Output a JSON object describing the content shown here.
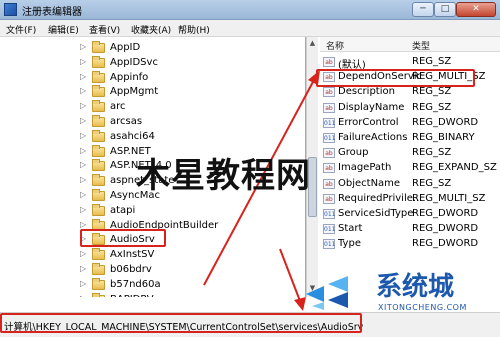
{
  "window": {
    "title": "注册表编辑器",
    "min_glyph": "─",
    "max_glyph": "□",
    "close_glyph": "✕"
  },
  "menu": {
    "items": [
      "文件(F)",
      "编辑(E)",
      "查看(V)",
      "收藏夹(A)",
      "帮助(H)"
    ]
  },
  "tree": {
    "items": [
      {
        "label": "AppID",
        "expandable": true
      },
      {
        "label": "AppIDSvc",
        "expandable": true
      },
      {
        "label": "Appinfo",
        "expandable": true
      },
      {
        "label": "AppMgmt",
        "expandable": true
      },
      {
        "label": "arc",
        "expandable": true
      },
      {
        "label": "arcsas",
        "expandable": true
      },
      {
        "label": "asahci64",
        "expandable": true
      },
      {
        "label": "ASP.NET",
        "expandable": true
      },
      {
        "label": "ASP.NET_4.0",
        "expandable": true
      },
      {
        "label": "aspnet_state",
        "expandable": true
      },
      {
        "label": "AsyncMac",
        "expandable": true
      },
      {
        "label": "atapi",
        "expandable": true
      },
      {
        "label": "AudioEndpointBuilder",
        "expandable": true
      },
      {
        "label": "AudioSrv",
        "expandable": true,
        "selected": true
      },
      {
        "label": "AxInstSV",
        "expandable": true
      },
      {
        "label": "b06bdrv",
        "expandable": true
      },
      {
        "label": "b57nd60a",
        "expandable": true
      },
      {
        "label": "BAPIDRV",
        "expandable": true
      }
    ]
  },
  "values": {
    "col_name": "名称",
    "col_type": "类型",
    "rows": [
      {
        "name": "(默认)",
        "type": "REG_SZ",
        "icon": "string-value-icon"
      },
      {
        "name": "DependOnService",
        "type": "REG_MULTI_SZ",
        "icon": "string-value-icon",
        "highlighted": true
      },
      {
        "name": "Description",
        "type": "REG_SZ",
        "icon": "string-value-icon"
      },
      {
        "name": "DisplayName",
        "type": "REG_SZ",
        "icon": "string-value-icon"
      },
      {
        "name": "ErrorControl",
        "type": "REG_DWORD",
        "icon": "binary-value-icon"
      },
      {
        "name": "FailureActions",
        "type": "REG_BINARY",
        "icon": "binary-value-icon"
      },
      {
        "name": "Group",
        "type": "REG_SZ",
        "icon": "string-value-icon"
      },
      {
        "name": "ImagePath",
        "type": "REG_EXPAND_SZ",
        "icon": "string-value-icon"
      },
      {
        "name": "ObjectName",
        "type": "REG_SZ",
        "icon": "string-value-icon"
      },
      {
        "name": "RequiredPrivile...",
        "type": "REG_MULTI_SZ",
        "icon": "string-value-icon"
      },
      {
        "name": "ServiceSidType",
        "type": "REG_DWORD",
        "icon": "binary-value-icon"
      },
      {
        "name": "Start",
        "type": "REG_DWORD",
        "icon": "binary-value-icon"
      },
      {
        "name": "Type",
        "type": "REG_DWORD",
        "icon": "binary-value-icon"
      }
    ]
  },
  "status": {
    "path": "计算机\\HKEY_LOCAL_MACHINE\\SYSTEM\\CurrentControlSet\\services\\AudioSrv"
  },
  "watermarks": {
    "center": "木星教程网",
    "brand": "系统城",
    "url": "XITONGCHENG.COM"
  },
  "colors": {
    "highlight_red": "#d8231c",
    "brand_blue": "#1c58ad"
  }
}
